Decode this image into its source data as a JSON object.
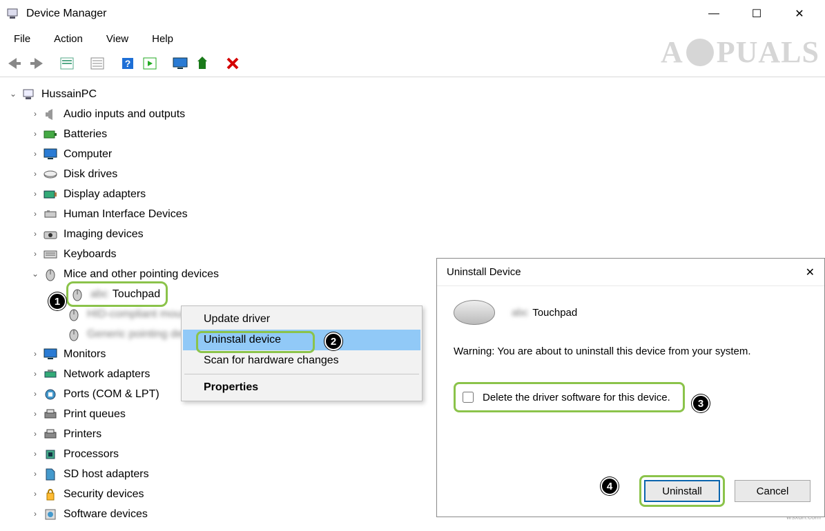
{
  "window": {
    "title": "Device Manager",
    "controls": {
      "minimize": "—",
      "maximize": "☐",
      "close": "✕"
    }
  },
  "menubar": [
    "File",
    "Action",
    "View",
    "Help"
  ],
  "toolbar_icons": [
    "back",
    "forward",
    "up-container",
    "properties-list",
    "help",
    "play-list",
    "monitor",
    "eject",
    "delete"
  ],
  "tree": {
    "root": "HussainPC",
    "nodes": [
      {
        "label": "Audio inputs and outputs",
        "icon": "speaker"
      },
      {
        "label": "Batteries",
        "icon": "battery"
      },
      {
        "label": "Computer",
        "icon": "monitor"
      },
      {
        "label": "Disk drives",
        "icon": "disk"
      },
      {
        "label": "Display adapters",
        "icon": "display"
      },
      {
        "label": "Human Interface Devices",
        "icon": "hid"
      },
      {
        "label": "Imaging devices",
        "icon": "camera"
      },
      {
        "label": "Keyboards",
        "icon": "keyboard"
      },
      {
        "label": "Mice and other pointing devices",
        "icon": "mouse",
        "expanded": true,
        "children": [
          {
            "label": "Touchpad",
            "highlighted": true
          },
          {
            "label": "blurred-device-1",
            "blurred": true
          },
          {
            "label": "blurred-device-2",
            "blurred": true
          }
        ]
      },
      {
        "label": "Monitors",
        "icon": "monitor"
      },
      {
        "label": "Network adapters",
        "icon": "network"
      },
      {
        "label": "Ports (COM & LPT)",
        "icon": "port"
      },
      {
        "label": "Print queues",
        "icon": "printer"
      },
      {
        "label": "Printers",
        "icon": "printer"
      },
      {
        "label": "Processors",
        "icon": "cpu"
      },
      {
        "label": "SD host adapters",
        "icon": "sd"
      },
      {
        "label": "Security devices",
        "icon": "security"
      },
      {
        "label": "Software devices",
        "icon": "software"
      }
    ]
  },
  "context_menu": {
    "items": [
      {
        "label": "Update driver"
      },
      {
        "label": "Uninstall device",
        "selected": true,
        "highlighted": true
      },
      {
        "label": "Scan for hardware changes"
      },
      {
        "sep": true
      },
      {
        "label": "Properties",
        "bold": true
      }
    ]
  },
  "dialog": {
    "title": "Uninstall Device",
    "device_name": "Touchpad",
    "warning": "Warning: You are about to uninstall this device from your system.",
    "checkbox_label": "Delete the driver software for this device.",
    "buttons": {
      "ok": "Uninstall",
      "cancel": "Cancel"
    }
  },
  "annotations": {
    "c1": "1",
    "c2": "2",
    "c3": "3",
    "c4": "4"
  },
  "watermark": {
    "pre": "A",
    "post": "PUALS"
  },
  "credit": "wsxdn.com"
}
